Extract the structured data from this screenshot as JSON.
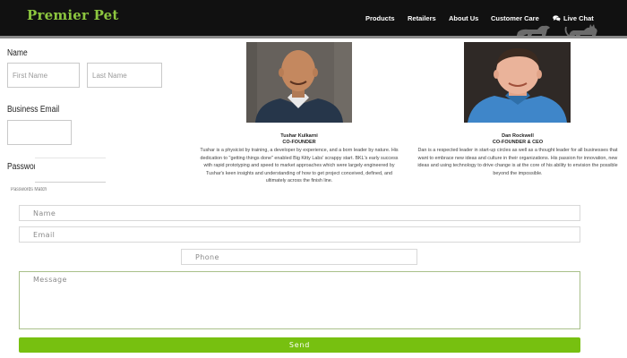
{
  "header": {
    "logo": "Premier Pet",
    "nav": {
      "products": "Products",
      "retailers": "Retailers",
      "about": "About Us",
      "care": "Customer Care",
      "chat": "Live Chat"
    }
  },
  "signup": {
    "name_label": "Name",
    "first_placeholder": "First Name",
    "last_placeholder": "Last Name",
    "email_label": "Business Email",
    "password_label": "Password",
    "password_hint": "Passwords Match"
  },
  "founders": [
    {
      "name": "Tushar Kulkarni",
      "title": "CO-FOUNDER",
      "bio": "Tushar is a physicist by training, a developer by experience, and a born leader by nature. His dedication to \"getting things done\" enabled Big Kitty Labs' scrappy start. BKL's early success with rapid prototyping and speed to market approaches which were largely engineered by Tushar's keen insights and understanding of how to get project conceived, defined, and ultimately across the finish line."
    },
    {
      "name": "Dan Rockwell",
      "title": "CO-FOUNDER & CEO",
      "bio": "Dan is a respected leader in start-up circles as well as a thought leader for all businesses that want to embrace new ideas and culture in their organizations. His passion for innovation, new ideas and using technology to drive change is at the core of his ability to envision the possible beyond the impossible."
    }
  ],
  "contact": {
    "name_placeholder": "Name",
    "email_placeholder": "Email",
    "phone_placeholder": "Phone",
    "message_placeholder": "Message",
    "send_label": "Send"
  },
  "colors": {
    "brand_green": "#8cc63f",
    "send_green": "#77c010",
    "header_bg": "#111111"
  },
  "icons": {
    "chat": "chat-bubbles-icon",
    "pets": "pets-silhouette-icon"
  }
}
